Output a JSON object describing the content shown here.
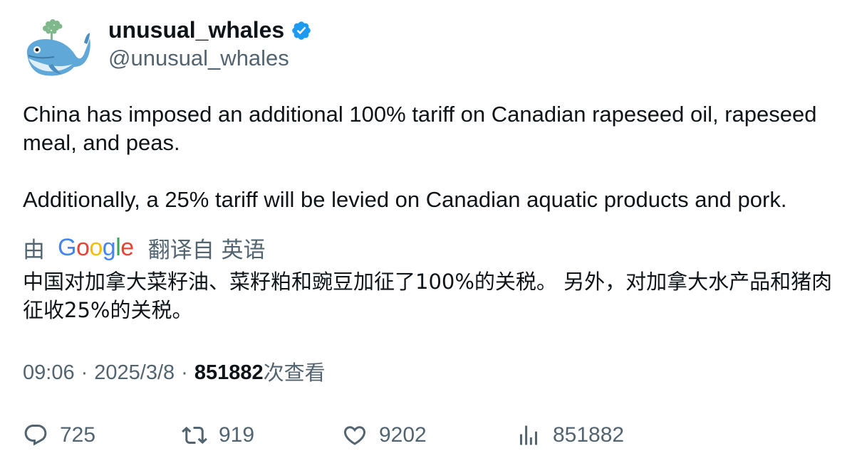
{
  "author": {
    "display_name": "unusual_whales",
    "handle": "@unusual_whales",
    "avatar_icon": "whale-avatar-icon",
    "verified_icon": "verified-badge-icon",
    "verified_color": "#1d9bf0"
  },
  "tweet": {
    "paragraph_1": "China has imposed an additional 100% tariff on Canadian rapeseed oil, rapeseed meal, and peas.",
    "paragraph_2": "Additionally, a 25% tariff will be levied on Canadian aquatic products and pork."
  },
  "translation": {
    "prefix": "由",
    "provider": "Google",
    "suffix": "翻译自 英语",
    "text": "中国对加拿大菜籽油、菜籽粕和豌豆加征了100%的关税。 另外，对加拿大水产品和猪肉征收25%的关税。"
  },
  "meta": {
    "time": "09:06",
    "date": "2025/3/8",
    "separator": "·",
    "views_count": "851882",
    "views_label": "次查看"
  },
  "actions": {
    "replies": "725",
    "retweets": "919",
    "likes": "9202",
    "views": "851882"
  },
  "colors": {
    "text_primary": "#0f1419",
    "text_secondary": "#536471",
    "google_blue": "#4285F4",
    "google_red": "#EA4335",
    "google_yellow": "#FBBC05",
    "google_green": "#34A853"
  }
}
